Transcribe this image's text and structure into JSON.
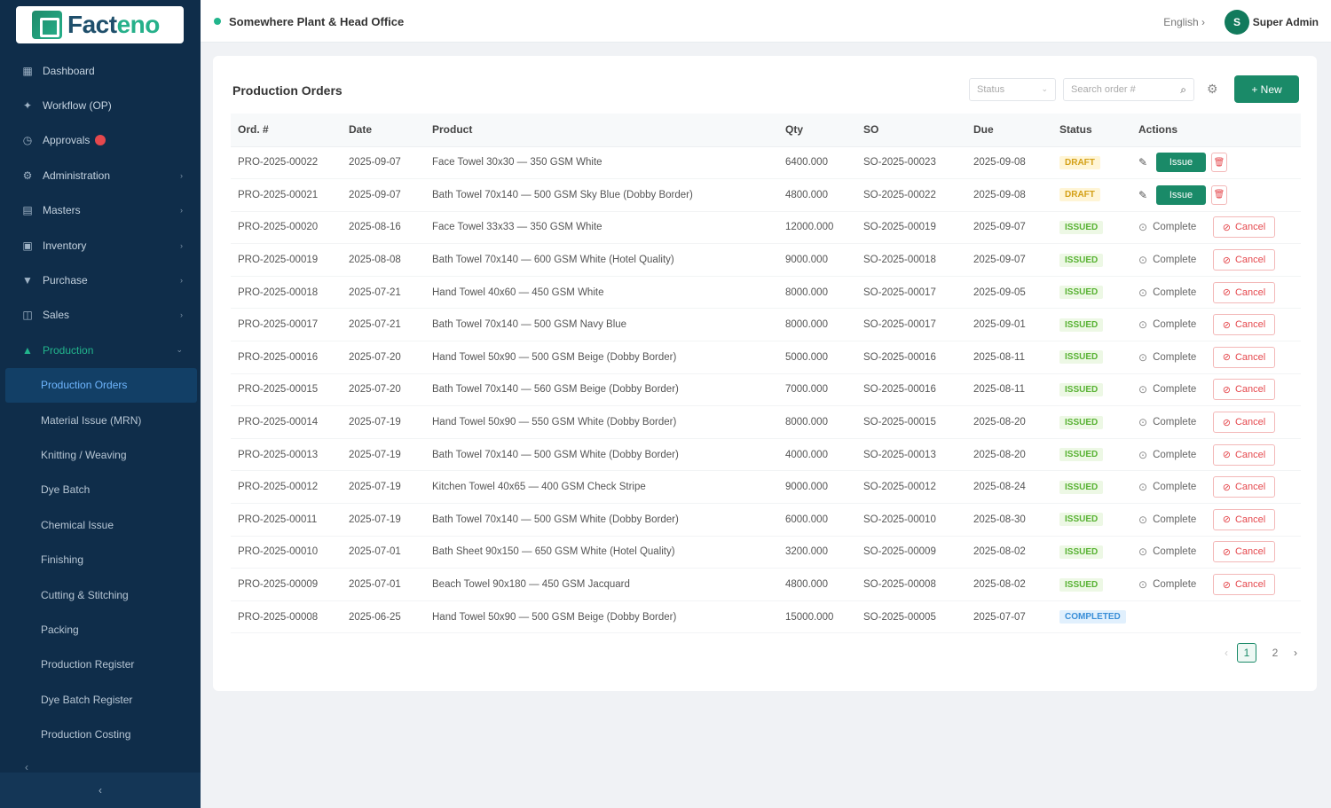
{
  "app": {
    "logo": {
      "text_main": "Fact",
      "text_accent": "eno"
    },
    "facility": "Somewhere Plant & Head Office",
    "language": "English",
    "user": {
      "initial": "S",
      "name": "Super Admin"
    }
  },
  "sidebar": {
    "items": [
      {
        "label": "Dashboard",
        "icon": "▦"
      },
      {
        "label": "Workflow (OP)",
        "icon": "✦"
      },
      {
        "label": "Approvals",
        "icon": "◷",
        "badge": true
      },
      {
        "label": "Administration",
        "icon": "⚙",
        "chevron": "›"
      },
      {
        "label": "Masters",
        "icon": "▤",
        "chevron": "›"
      },
      {
        "label": "Inventory",
        "icon": "▣",
        "chevron": "›"
      },
      {
        "label": "Purchase",
        "icon": "▼",
        "chevron": "›"
      },
      {
        "label": "Sales",
        "icon": "◫",
        "chevron": "›"
      },
      {
        "label": "Production",
        "icon": "▲",
        "chevron": "⌄"
      }
    ],
    "sub_items": [
      {
        "label": "Production Orders"
      },
      {
        "label": "Material Issue (MRN)"
      },
      {
        "label": "Knitting / Weaving"
      },
      {
        "label": "Dye Batch"
      },
      {
        "label": "Chemical Issue"
      },
      {
        "label": "Finishing"
      },
      {
        "label": "Cutting & Stitching"
      },
      {
        "label": "Packing"
      },
      {
        "label": "Production Register"
      },
      {
        "label": "Dye Batch Register"
      },
      {
        "label": "Production Costing"
      }
    ],
    "bottom_text": "‹",
    "collapse_label": "‹"
  },
  "page": {
    "title": "Production Orders",
    "filter_select": {
      "placeholder": "Status",
      "arrow": "⌄"
    },
    "search": {
      "placeholder": "Search order #",
      "icon": "⌕"
    },
    "gear_icon": "⚙",
    "new_button": "+ New"
  },
  "table": {
    "headers": {
      "order": "Ord. #",
      "date": "Date",
      "product": "Product",
      "qty": "Qty",
      "so": "SO",
      "due": "Due",
      "status": "Status",
      "actions": "Actions"
    },
    "rows": [
      {
        "order": "PRO-2025-00022",
        "date": "2025-09-07",
        "product": "Face Towel 30x30 — 350 GSM White",
        "qty": "6400.000",
        "so": "SO-2025-00023",
        "due": "2025-09-08",
        "status": "DRAFT",
        "kind": "draft"
      },
      {
        "order": "PRO-2025-00021",
        "date": "2025-09-07",
        "product": "Bath Towel 70x140 — 500 GSM Sky Blue (Dobby Border)",
        "qty": "4800.000",
        "so": "SO-2025-00022",
        "due": "2025-09-08",
        "status": "DRAFT",
        "kind": "draft"
      },
      {
        "order": "PRO-2025-00020",
        "date": "2025-08-16",
        "product": "Face Towel 33x33 — 350 GSM White",
        "qty": "12000.000",
        "so": "SO-2025-00019",
        "due": "2025-09-07",
        "status": "ISSUED",
        "kind": "issued"
      },
      {
        "order": "PRO-2025-00019",
        "date": "2025-08-08",
        "product": "Bath Towel 70x140 — 600 GSM White (Hotel Quality)",
        "qty": "9000.000",
        "so": "SO-2025-00018",
        "due": "2025-09-07",
        "status": "ISSUED",
        "kind": "issued"
      },
      {
        "order": "PRO-2025-00018",
        "date": "2025-07-21",
        "product": "Hand Towel 40x60 — 450 GSM White",
        "qty": "8000.000",
        "so": "SO-2025-00017",
        "due": "2025-09-05",
        "status": "ISSUED",
        "kind": "issued"
      },
      {
        "order": "PRO-2025-00017",
        "date": "2025-07-21",
        "product": "Bath Towel 70x140 — 500 GSM Navy Blue",
        "qty": "8000.000",
        "so": "SO-2025-00017",
        "due": "2025-09-01",
        "status": "ISSUED",
        "kind": "issued"
      },
      {
        "order": "PRO-2025-00016",
        "date": "2025-07-20",
        "product": "Hand Towel 50x90 — 500 GSM Beige (Dobby Border)",
        "qty": "5000.000",
        "so": "SO-2025-00016",
        "due": "2025-08-11",
        "status": "ISSUED",
        "kind": "issued"
      },
      {
        "order": "PRO-2025-00015",
        "date": "2025-07-20",
        "product": "Bath Towel 70x140 — 560 GSM Beige (Dobby Border)",
        "qty": "7000.000",
        "so": "SO-2025-00016",
        "due": "2025-08-11",
        "status": "ISSUED",
        "kind": "issued"
      },
      {
        "order": "PRO-2025-00014",
        "date": "2025-07-19",
        "product": "Hand Towel 50x90 — 550 GSM White (Dobby Border)",
        "qty": "8000.000",
        "so": "SO-2025-00015",
        "due": "2025-08-20",
        "status": "ISSUED",
        "kind": "issued"
      },
      {
        "order": "PRO-2025-00013",
        "date": "2025-07-19",
        "product": "Bath Towel 70x140 — 500 GSM White (Dobby Border)",
        "qty": "4000.000",
        "so": "SO-2025-00013",
        "due": "2025-08-20",
        "status": "ISSUED",
        "kind": "issued"
      },
      {
        "order": "PRO-2025-00012",
        "date": "2025-07-19",
        "product": "Kitchen Towel 40x65 — 400 GSM Check Stripe",
        "qty": "9000.000",
        "so": "SO-2025-00012",
        "due": "2025-08-24",
        "status": "ISSUED",
        "kind": "issued"
      },
      {
        "order": "PRO-2025-00011",
        "date": "2025-07-19",
        "product": "Bath Towel 70x140 — 500 GSM White (Dobby Border)",
        "qty": "6000.000",
        "so": "SO-2025-00010",
        "due": "2025-08-30",
        "status": "ISSUED",
        "kind": "issued"
      },
      {
        "order": "PRO-2025-00010",
        "date": "2025-07-01",
        "product": "Bath Sheet 90x150 — 650 GSM White (Hotel Quality)",
        "qty": "3200.000",
        "so": "SO-2025-00009",
        "due": "2025-08-02",
        "status": "ISSUED",
        "kind": "issued"
      },
      {
        "order": "PRO-2025-00009",
        "date": "2025-07-01",
        "product": "Beach Towel 90x180 — 450 GSM Jacquard",
        "qty": "4800.000",
        "so": "SO-2025-00008",
        "due": "2025-08-02",
        "status": "ISSUED",
        "kind": "issued"
      },
      {
        "order": "PRO-2025-00008",
        "date": "2025-06-25",
        "product": "Hand Towel 50x90 — 500 GSM Beige (Dobby Border)",
        "qty": "15000.000",
        "so": "SO-2025-00005",
        "due": "2025-07-07",
        "status": "COMPLETED",
        "kind": "completed"
      }
    ],
    "actions": {
      "issue": "Issue",
      "complete": "Complete",
      "cancel": "Cancel",
      "edit_icon": "✎",
      "delete_icon": "🗑",
      "complete_icon": "⊙",
      "cancel_icon": "⊘"
    }
  },
  "pager": {
    "prev": "‹",
    "pages": [
      "1",
      "2"
    ],
    "current": "1",
    "next": "›"
  }
}
